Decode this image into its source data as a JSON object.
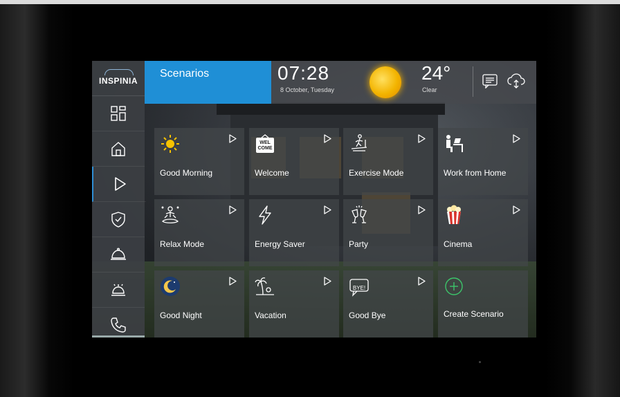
{
  "app": {
    "brand": "INSPINIA"
  },
  "header": {
    "title": "Scenarios",
    "time": "07:28",
    "date": "8 October, Tuesday",
    "temperature": "24°",
    "condition": "Clear"
  },
  "sidebar": {
    "items": [
      {
        "name": "dashboard",
        "icon": "dashboard-icon"
      },
      {
        "name": "home",
        "icon": "home-icon"
      },
      {
        "name": "scenarios",
        "icon": "play-icon",
        "active": true
      },
      {
        "name": "security",
        "icon": "shield-icon"
      },
      {
        "name": "room-service",
        "icon": "cloche-icon"
      },
      {
        "name": "reception",
        "icon": "bell-icon"
      },
      {
        "name": "phone",
        "icon": "phone-icon"
      }
    ]
  },
  "scenarios": [
    {
      "label": "Good Morning",
      "icon": "sun-icon"
    },
    {
      "label": "Welcome",
      "icon": "welcome-sign-icon",
      "icon_text": "WEL COME"
    },
    {
      "label": "Exercise Mode",
      "icon": "treadmill-icon"
    },
    {
      "label": "Work from Home",
      "icon": "desk-worker-icon"
    },
    {
      "label": "Relax Mode",
      "icon": "meditation-icon"
    },
    {
      "label": "Energy Saver",
      "icon": "lightning-icon"
    },
    {
      "label": "Party",
      "icon": "cheers-icon"
    },
    {
      "label": "Cinema",
      "icon": "popcorn-icon"
    },
    {
      "label": "Good Night",
      "icon": "moon-icon"
    },
    {
      "label": "Vacation",
      "icon": "palm-tree-icon"
    },
    {
      "label": "Good Bye",
      "icon": "bye-bubble-icon",
      "icon_text": "BYE!"
    },
    {
      "label": "Create Scenario",
      "icon": "add-circle-icon"
    }
  ],
  "colors": {
    "accent": "#1f8fd6",
    "sun": "#f3b400",
    "add": "#3cc46a",
    "popcorn": "#d9342b"
  }
}
